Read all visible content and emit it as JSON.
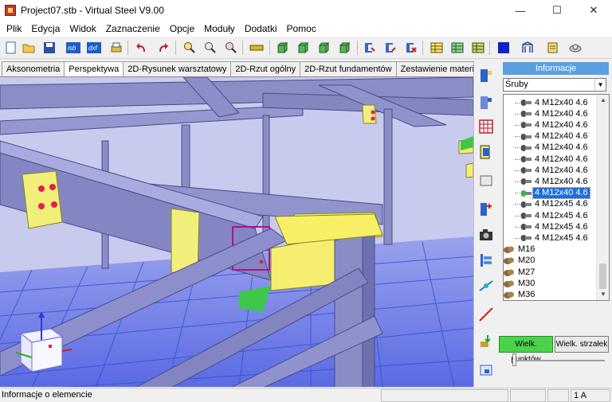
{
  "window": {
    "title": "Project07.stb  - Virtual Steel V9.00",
    "minimize_label": "—",
    "maximize_label": "☐",
    "close_label": "✕"
  },
  "menu": [
    "Plik",
    "Edycja",
    "Widok",
    "Zaznaczenie",
    "Opcje",
    "Moduły",
    "Dodatki",
    "Pomoc"
  ],
  "toolbar": {
    "icons": [
      "new-file-icon",
      "open-folder-icon",
      "save-icon",
      "isb-export-icon",
      "dxf-export-icon",
      "print-icon",
      "undo-icon",
      "redo-icon",
      "zoom-in-icon",
      "zoom-fit-icon",
      "zoom-out-icon",
      "measure-icon",
      "profile-view-icon-1",
      "profile-view-icon-2",
      "profile-view-icon-3",
      "profile-view-icon-4",
      "filter-icon-1",
      "filter-icon-2",
      "filter-icon-3",
      "table-icon-1",
      "table-icon-2",
      "table-icon-3",
      "color-blue-icon",
      "structure-icon",
      "report-icon",
      "settings-icon"
    ],
    "isb_label": "isb",
    "dxf_label": "dxf"
  },
  "tabs": [
    {
      "label": "Aksonometria",
      "active": false
    },
    {
      "label": "Perspektywa",
      "active": true
    },
    {
      "label": "2D-Rysunek warsztatowy",
      "active": false
    },
    {
      "label": "2D-Rzut ogólny",
      "active": false
    },
    {
      "label": "2D-Rzut fundamentów",
      "active": false
    },
    {
      "label": "Zestawienie materiału",
      "active": false
    }
  ],
  "side_toolbar_icons": [
    "beam-view-icon",
    "beam-edit-icon",
    "grid-icon",
    "section-icon",
    "sheet-icon",
    "add-beam-icon",
    "camera-icon",
    "align-icon",
    "connection-icon",
    "line-tool-icon",
    "import-icon",
    "window-icon"
  ],
  "panel": {
    "header": "Informacje",
    "dropdown_value": "Śruby",
    "tree": [
      {
        "label": "4 M12x40 4.6",
        "type": "bolt",
        "selected": false
      },
      {
        "label": "4 M12x40 4.6",
        "type": "bolt",
        "selected": false
      },
      {
        "label": "4 M12x40 4.6",
        "type": "bolt",
        "selected": false
      },
      {
        "label": "4 M12x40 4.6",
        "type": "bolt",
        "selected": false
      },
      {
        "label": "4 M12x40 4.6",
        "type": "bolt",
        "selected": false
      },
      {
        "label": "4 M12x40 4.6",
        "type": "bolt",
        "selected": false
      },
      {
        "label": "4 M12x40 4.6",
        "type": "bolt",
        "selected": false
      },
      {
        "label": "4 M12x40 4.6",
        "type": "bolt",
        "selected": false
      },
      {
        "label": "4 M12x40 4.6",
        "type": "bolt",
        "selected": true
      },
      {
        "label": "4 M12x45 4.6",
        "type": "bolt",
        "selected": false
      },
      {
        "label": "4 M12x45 4.6",
        "type": "bolt",
        "selected": false
      },
      {
        "label": "4 M12x45 4.6",
        "type": "bolt",
        "selected": false
      },
      {
        "label": "4 M12x45 4.6",
        "type": "bolt",
        "selected": false
      },
      {
        "label": "M16",
        "type": "group",
        "selected": false
      },
      {
        "label": "M20",
        "type": "group",
        "selected": false
      },
      {
        "label": "M27",
        "type": "group",
        "selected": false
      },
      {
        "label": "M30",
        "type": "group",
        "selected": false
      },
      {
        "label": "M36",
        "type": "group",
        "selected": false
      }
    ],
    "points_button": "Wielk. punktów",
    "arrows_button": "Wielk. strzałek",
    "selected_color": "#1e6fd9"
  },
  "status": {
    "text": "Informacje o elemencie",
    "cell_right": "1 A"
  },
  "colors": {
    "beam": "#8e90c4",
    "plate": "#f2ee7a",
    "bolt": "#e0204a",
    "background": "#c7c9ef",
    "grid": "#3f5fe0"
  }
}
